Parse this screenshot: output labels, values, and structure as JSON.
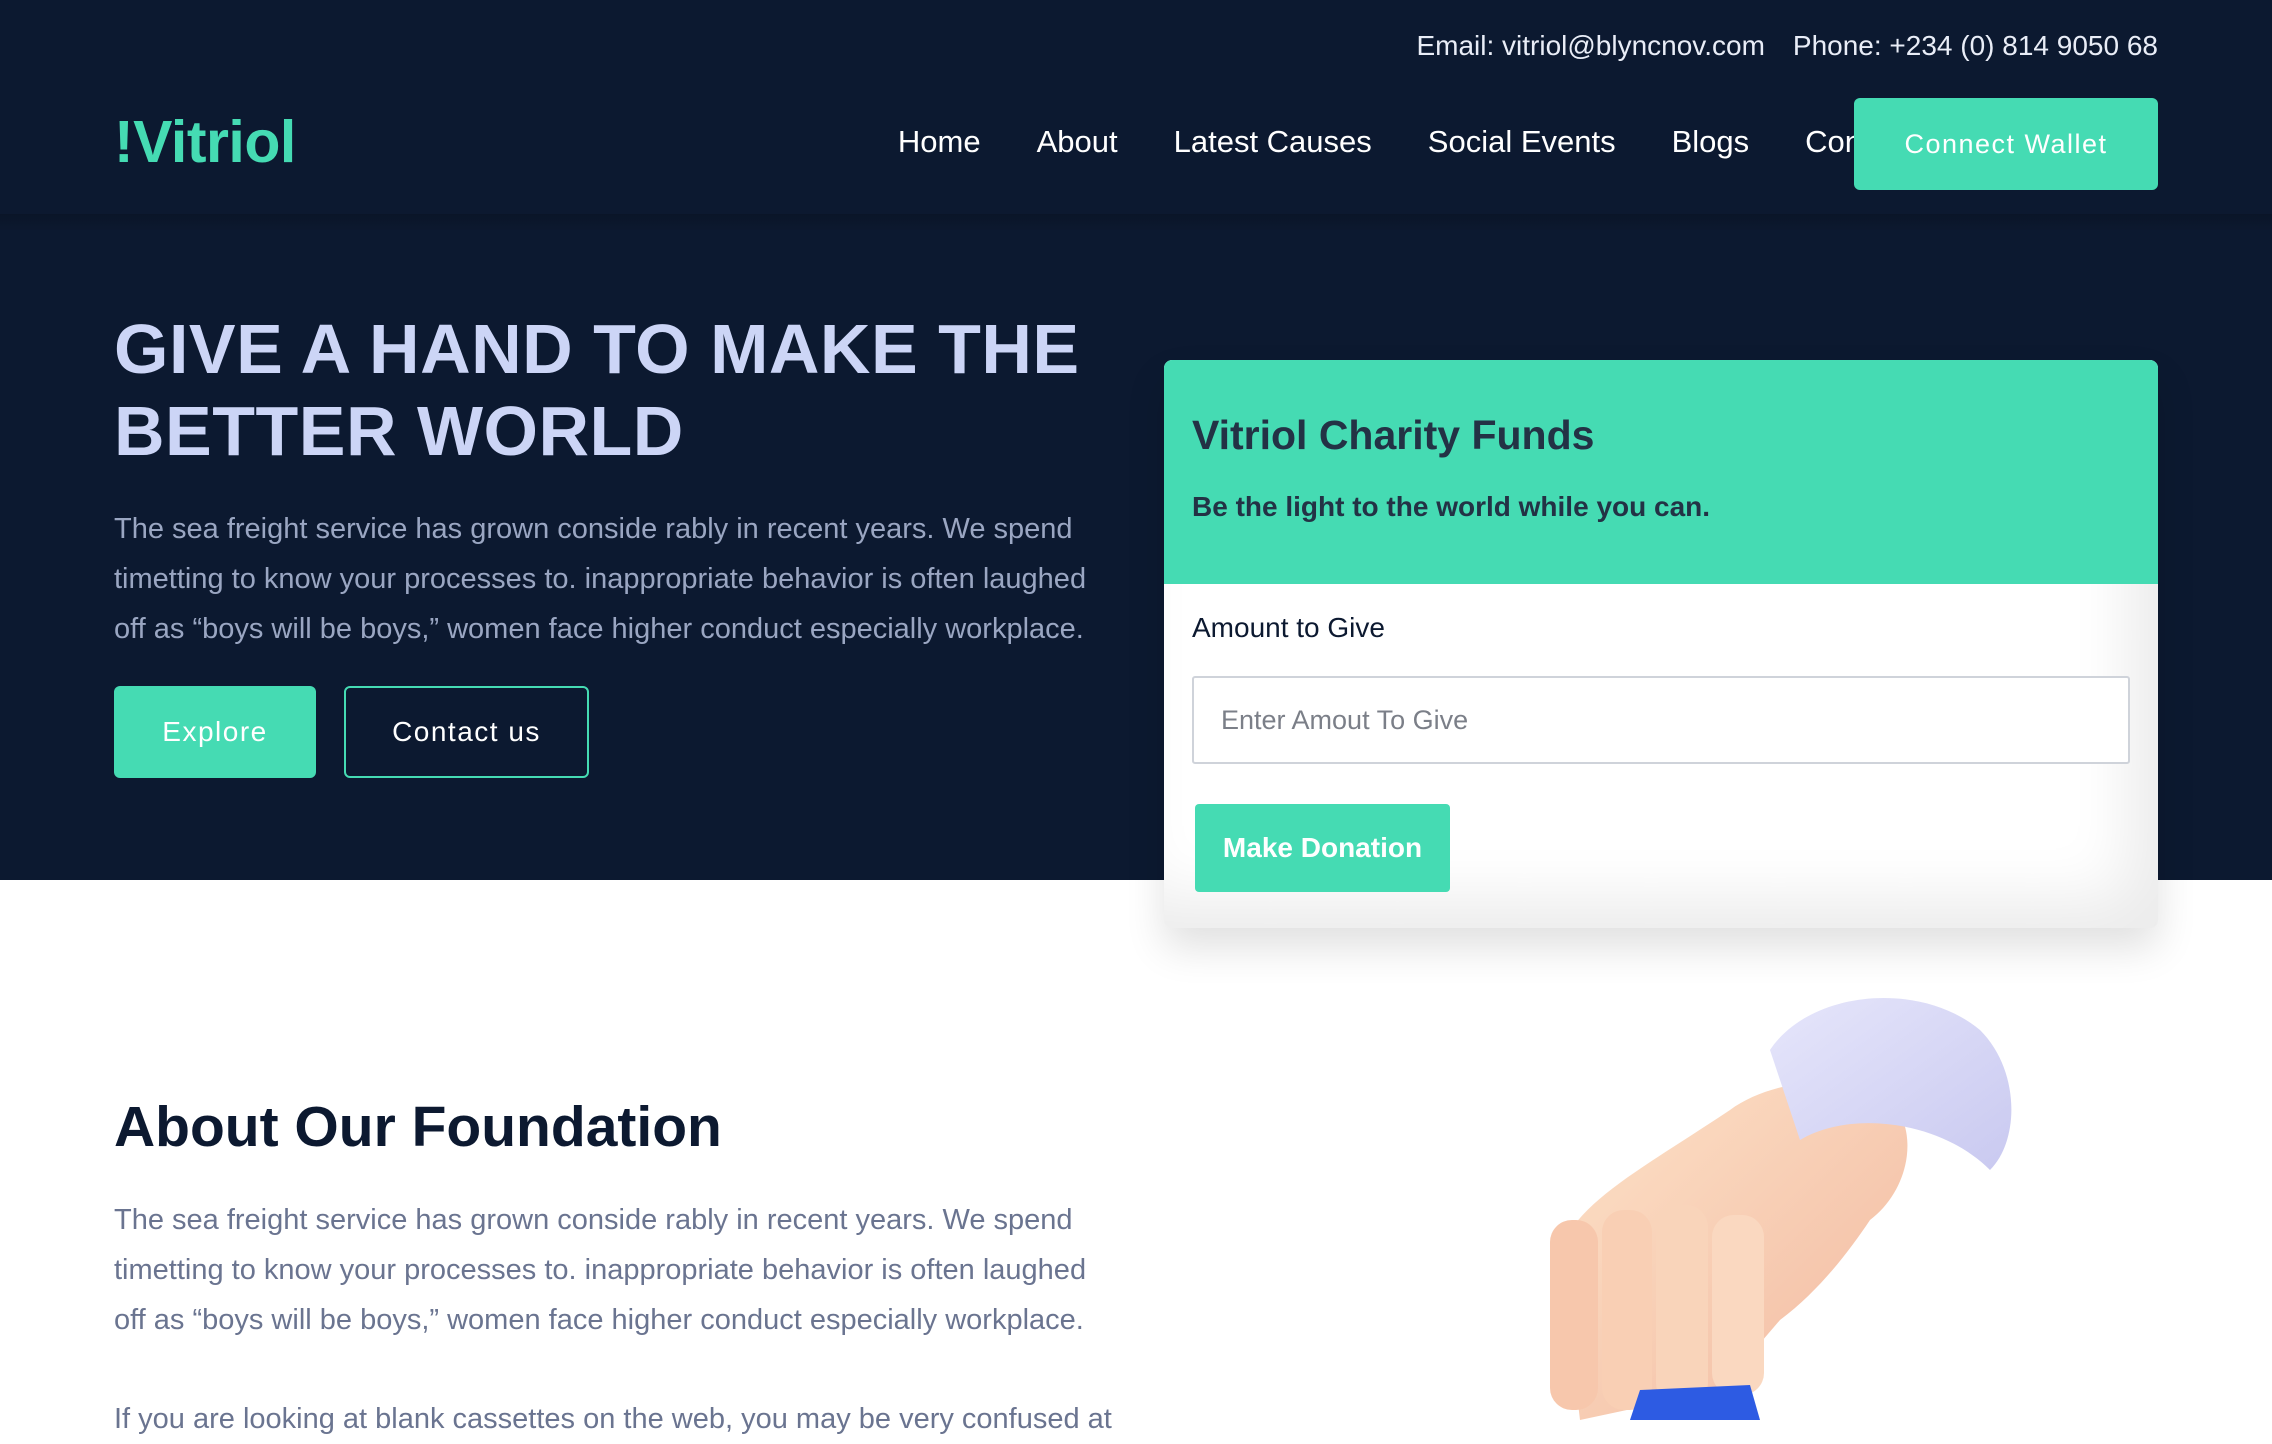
{
  "topbar": {
    "email": "Email: vitriol@blyncnov.com",
    "phone": "Phone: +234 (0) 814 9050 68"
  },
  "brand": {
    "logo": "!Vitriol",
    "accent_color": "#45dbb3",
    "dark_color": "#0c1930"
  },
  "nav": {
    "items": [
      "Home",
      "About",
      "Latest Causes",
      "Social Events",
      "Blogs",
      "Contact"
    ],
    "connect_label": "Connect Wallet"
  },
  "hero": {
    "title": "GIVE A HAND TO MAKE THE BETTER WORLD",
    "text": "The sea freight service has grown conside rably in recent years. We spend timetting to know your processes to. inappropriate behavior is often laughed off as “boys will be boys,” women face higher conduct especially workplace.",
    "explore_label": "Explore",
    "contact_label": "Contact us"
  },
  "donation": {
    "title": "Vitriol Charity Funds",
    "subtitle": "Be the light to the world while you can.",
    "amount_label": "Amount to Give",
    "amount_placeholder": "Enter Amout To Give",
    "amount_value": "",
    "submit_label": "Make Donation"
  },
  "about": {
    "title": "About Our Foundation",
    "text": "The sea freight service has grown conside rably in recent years. We spend timetting to know your processes to. inappropriate behavior is often laughed off as “boys will be boys,” women face higher conduct especially workplace.",
    "text2": "If you are looking at blank cassettes on the web, you may be very confused at"
  }
}
